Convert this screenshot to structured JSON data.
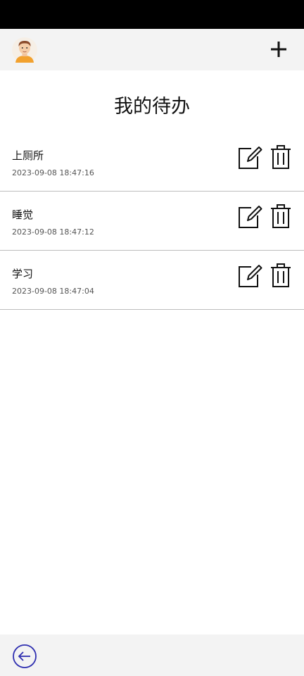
{
  "header": {
    "avatar_icon": "user-avatar-icon",
    "add_icon": "plus-icon"
  },
  "page": {
    "title": "我的待办"
  },
  "todos": [
    {
      "title": "上厕所",
      "time": "2023-09-08 18:47:16"
    },
    {
      "title": "睡觉",
      "time": "2023-09-08 18:47:12"
    },
    {
      "title": "学习",
      "time": "2023-09-08 18:47:04"
    }
  ],
  "item_icons": {
    "edit": "edit-icon",
    "delete": "trash-icon"
  },
  "footer": {
    "back_icon": "arrow-left-circle-icon"
  },
  "colors": {
    "bar_background": "#f3f3f3",
    "status_bar": "#000000",
    "back_icon": "#2f2fb0",
    "avatar_shirt": "#f2a12e",
    "avatar_hair": "#8a4a2a"
  }
}
